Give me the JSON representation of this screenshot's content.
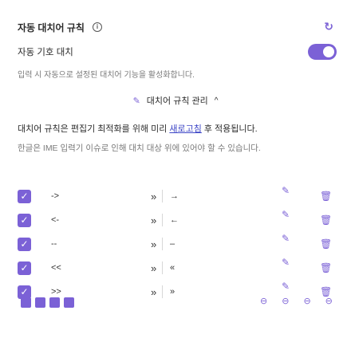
{
  "header": {
    "title": "자동 대치어 규칙",
    "info_icon": "info-circle-icon",
    "reset_icon": "reset-icon",
    "reset_glyph": "↻"
  },
  "auto_replace": {
    "label": "자동 기호 대치",
    "enabled": true,
    "description": "입력 시 자동으로 설정된 대치어 기능을 활성화합니다."
  },
  "section": {
    "icon": "sparkle-edit-icon",
    "icon_glyph": "✎",
    "label": "대치어 규칙 관리",
    "chevron": "^"
  },
  "help": {
    "line1_pre": "대치어 규칙은",
    "line1_mid": "편집기",
    "line1_post": "최적화를 위해",
    "line1_pre2": "미리 ",
    "line1_link": "새로고침",
    "line1_end": "후 적용됩니다.",
    "line2": "한글은 IME 입력기 이슈로 인해 대치 대상 위에 있어야 할 수 있습니다."
  },
  "rules": [
    {
      "enabled": true,
      "from": "->",
      "arrow": "»",
      "to": "→",
      "edit_glyph": "✎",
      "delete_glyph": "🗑"
    },
    {
      "enabled": true,
      "from": "<-",
      "arrow": "»",
      "to": "←",
      "edit_glyph": "✎",
      "delete_glyph": "🗑"
    },
    {
      "enabled": true,
      "from": "--",
      "arrow": "»",
      "to": "–",
      "edit_glyph": "✎",
      "delete_glyph": "🗑"
    },
    {
      "enabled": true,
      "from": "<<",
      "arrow": "»",
      "to": "«",
      "edit_glyph": "✎",
      "delete_glyph": "🗑"
    },
    {
      "enabled": true,
      "from": ">>",
      "arrow": "»",
      "to": "»",
      "edit_glyph": "✎",
      "delete_glyph": "🗑"
    }
  ],
  "colors": {
    "accent": "#7b61d6",
    "link": "#3d46c6",
    "muted": "#7a7a7a"
  }
}
